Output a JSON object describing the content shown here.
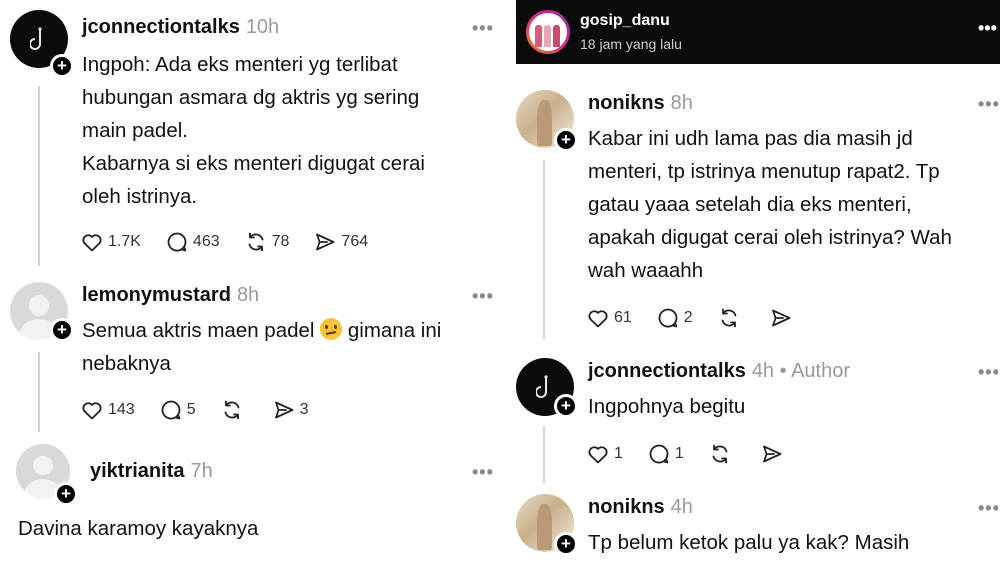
{
  "left": {
    "posts": [
      {
        "username": "jconnectiontalks",
        "time": "10h",
        "lines": [
          "Ingpoh: Ada eks menteri yg terlibat",
          "hubungan asmara dg aktris yg sering",
          "main padel.",
          "Kabarnya si eks menteri digugat cerai",
          "oleh istrinya."
        ],
        "likes": "1.7K",
        "comments": "463",
        "reposts": "78",
        "shares": "764"
      },
      {
        "username": "lemonymustard",
        "time": "8h",
        "line1_before": "Semua aktris maen padel",
        "line1_after": "gimana ini",
        "line2": "nebaknya",
        "emoji": "confused-face",
        "likes": "143",
        "comments": "5",
        "reposts": "",
        "shares": "3"
      },
      {
        "username": "yiktrianita",
        "time": "7h",
        "text": "Davina karamoy kayaknya"
      }
    ]
  },
  "right": {
    "header": {
      "account": "gosip_danu",
      "time": "18 jam yang lalu"
    },
    "posts": [
      {
        "username": "nonikns",
        "time": "8h",
        "lines": [
          "Kabar ini udh lama pas dia masih jd",
          "menteri, tp istrinya menutup rapat2. Tp",
          "gatau yaaa setelah dia eks menteri,",
          "apakah digugat cerai oleh istrinya? Wah",
          "wah waaahh"
        ],
        "likes": "61",
        "comments": "2"
      },
      {
        "username": "jconnectiontalks",
        "time": "4h",
        "author": "• Author",
        "text": "Ingpohnya begitu",
        "likes": "1",
        "comments": "1"
      },
      {
        "username": "nonikns",
        "time": "4h",
        "text": "Tp belum ketok palu ya kak? Masih"
      }
    ]
  },
  "icons": [
    "heart-icon",
    "comment-icon",
    "repost-icon",
    "share-icon",
    "more-icon",
    "follow-plus-icon"
  ],
  "colors": {
    "text": "#111111",
    "muted": "#9a9a9a",
    "topbar": "#0b0b0b",
    "thread_line": "#d6d6d6"
  }
}
